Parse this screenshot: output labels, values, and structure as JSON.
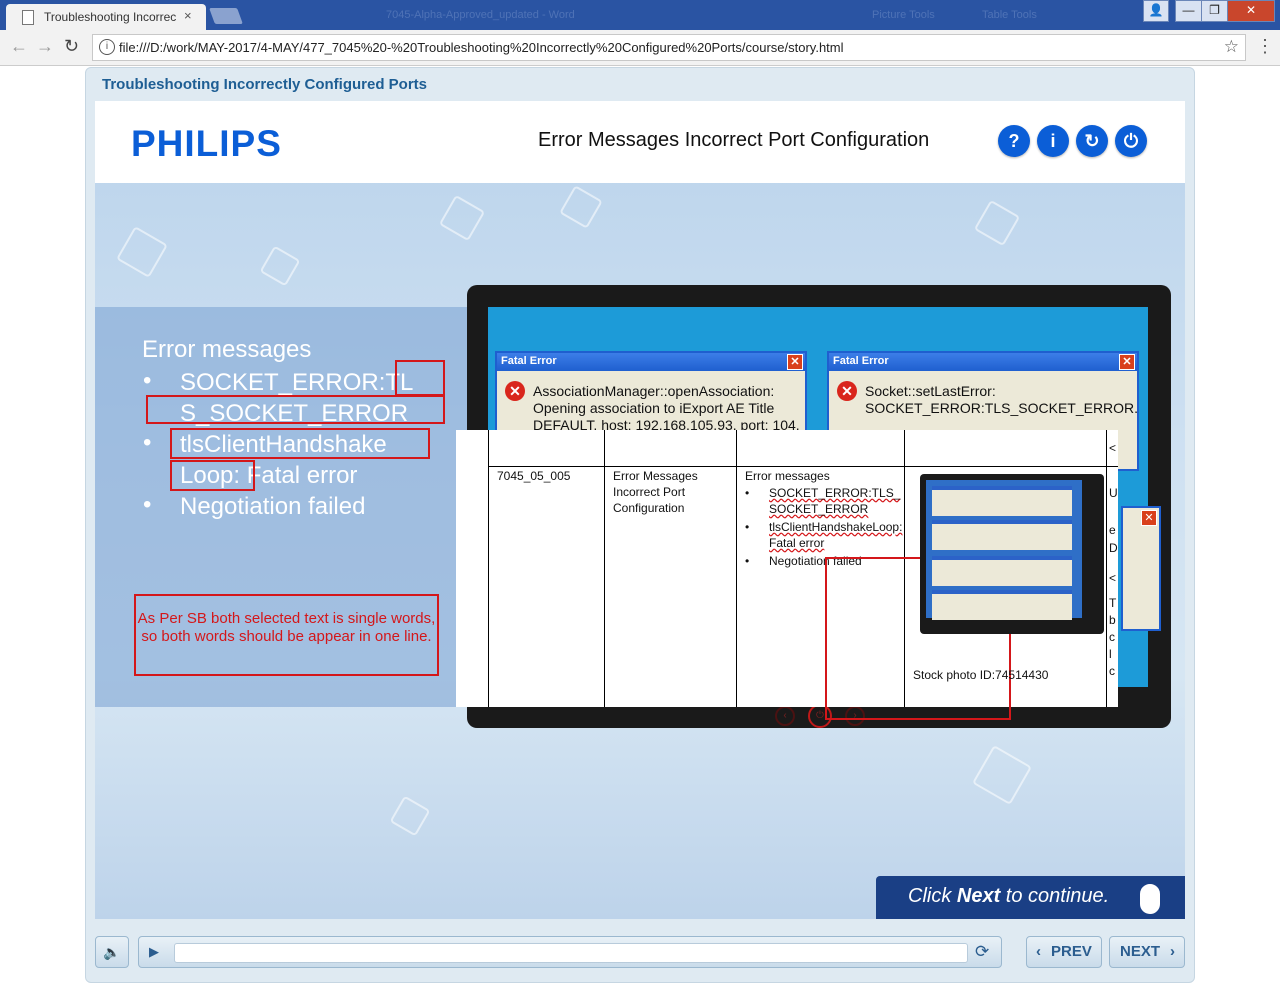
{
  "browser": {
    "tab_title": "Troubleshooting Incorrec",
    "tab_close": "×",
    "url": "file:///D:/work/MAY-2017/4-MAY/477_7045%20-%20Troubleshooting%20Incorrectly%20Configured%20Ports/course/story.html",
    "back_glyph": "←",
    "forward_glyph": "→",
    "reload_glyph": "↻",
    "info_glyph": "i",
    "star_glyph": "☆",
    "menu_glyph": "⋮",
    "minimize_glyph": "—",
    "maximize_glyph": "❐",
    "close_glyph": "✕",
    "user_glyph": "👤",
    "background_tab_texts": [
      "7045-Alpha-Approved_updated - Word",
      "Picture Tools",
      "Table Tools"
    ]
  },
  "course": {
    "title": "Troubleshooting Incorrectly Configured Ports"
  },
  "slide": {
    "logo": "PHILIPS",
    "title": "Error Messages Incorrect Port Configuration",
    "header_buttons": {
      "help": "?",
      "info": "i",
      "replay": "↻",
      "exit": "⏻"
    },
    "error_heading": "Error messages",
    "bullets": [
      {
        "line1": "SOCKET_ERROR:TL",
        "line2": "S_SOCKET_ERROR"
      },
      {
        "line1": "tlsClientHandshake",
        "line2": "Loop: Fatal error"
      },
      {
        "line1": "Negotiation failed"
      }
    ],
    "bullet_glyph": "•",
    "note": "As Per SB both selected text is single words, so both words should be appear in one line.",
    "dialogs": [
      {
        "title": "Fatal Error",
        "message": "AssociationManager::openAssociation: Opening association to iExport AE Title DEFAULT, host: 192.168.105.93, port: 104."
      },
      {
        "title": "Fatal Error",
        "message": "Socket::setLastError: SOCKET_ERROR:TLS_SOCKET_ERROR."
      }
    ],
    "dialog_close": "✕",
    "monitor_buttons": [
      "‹",
      "⏻",
      "›"
    ],
    "table": {
      "id": "7045_05_005",
      "topic": "Error Messages Incorrect Port Configuration",
      "heading": "Error messages",
      "items": [
        "SOCKET_ERROR:TLS_SOCKET_ERROR",
        "tlsClientHandshakeLoop: Fatal error",
        "Negotiation failed"
      ],
      "stock_photo": "Stock photo ID:74514430",
      "edge_fragments": [
        "<",
        "U",
        "e",
        "D",
        "<",
        "T",
        "b",
        "c",
        "l",
        "c"
      ]
    },
    "click_next": {
      "prefix": "Click ",
      "bold": "Next",
      "suffix": " to continue."
    }
  },
  "controls": {
    "mute_glyph": "🔈",
    "play_glyph": "▶",
    "replay_glyph": "⟳",
    "prev_label": "PREV",
    "next_label": "NEXT",
    "prev_arrow": "‹",
    "next_arrow": "›"
  }
}
